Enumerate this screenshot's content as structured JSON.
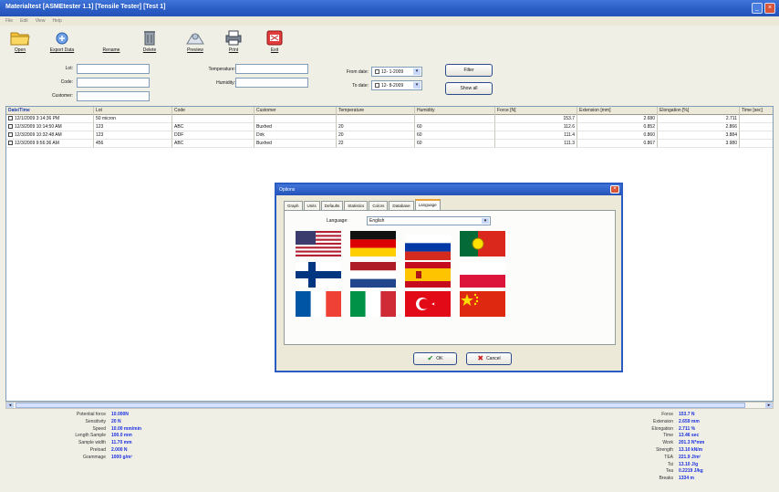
{
  "window": {
    "title": "Materialtest [ASMEtester 1.1] [Tensile Tester] [Test 1]"
  },
  "menu": [
    "File",
    "Edit",
    "View",
    "Help"
  ],
  "toolbar": [
    {
      "label": "Open",
      "icon": "folder-icon"
    },
    {
      "label": "Export Data",
      "icon": "export-icon"
    },
    {
      "label": "Rename",
      "icon": "rename-icon"
    },
    {
      "label": "Delete",
      "icon": "trash-icon"
    },
    {
      "label": "Preview",
      "icon": "preview-icon"
    },
    {
      "label": "Print",
      "icon": "printer-icon"
    },
    {
      "label": "Exit",
      "icon": "exit-icon"
    }
  ],
  "filters": {
    "lot_label": "Lot:",
    "lot_value": "",
    "code_label": "Code:",
    "code_value": "",
    "customer_label": "Customer:",
    "customer_value": "",
    "temperature_label": "Temperature:",
    "temperature_value": "",
    "humidity_label": "Humidity:",
    "humidity_value": "",
    "from_date_label": "From date:",
    "from_date_value": "12- 1-2009",
    "to_date_label": "To date:",
    "to_date_value": "12- 8-2009",
    "filter_button": "Filter",
    "show_all_button": "Show all"
  },
  "table": {
    "columns": [
      "Date/Time",
      "Lot",
      "Code",
      "Customer",
      "Temperature",
      "Humidity",
      "Force [N]",
      "Extension [mm]",
      "Elongation [%]",
      "Time [sec]"
    ],
    "rows": [
      [
        "12/1/2009 3:14:36 PM",
        "50 micron",
        "",
        "",
        "",
        "",
        "153.7",
        "2.680",
        "2.711",
        ""
      ],
      [
        "12/3/2009 10:14:50 AM",
        "123",
        "ABC",
        "Buxhed",
        "20",
        "60",
        "112.6",
        "0.852",
        "2.866",
        ""
      ],
      [
        "12/3/2009 10:32:48 AM",
        "123",
        "DDF",
        "Dirk",
        "20",
        "60",
        "111.4",
        "0.860",
        "3.884",
        ""
      ],
      [
        "12/3/2009 9:56:36 AM",
        "456",
        "ABC",
        "Buxhed",
        "22",
        "60",
        "111.3",
        "0.867",
        "3.980",
        ""
      ]
    ]
  },
  "settings_left": [
    {
      "label": "Potential force",
      "value": "10.000N"
    },
    {
      "label": "Sensitivity",
      "value": "20 N"
    },
    {
      "label": "Speed",
      "value": "10.00 mm/min"
    },
    {
      "label": "Length Sample",
      "value": "100.0 mm"
    },
    {
      "label": "Sample width",
      "value": "11.70 mm"
    },
    {
      "label": "Preload",
      "value": "2.000 N"
    },
    {
      "label": "Grammage",
      "value": "1000 g/m²"
    }
  ],
  "results_right": [
    {
      "label": "Force",
      "value": "153.7 N"
    },
    {
      "label": "Extension",
      "value": "2.659 mm"
    },
    {
      "label": "Elongation",
      "value": "2.711 %"
    },
    {
      "label": "Time",
      "value": "13.46 sec"
    },
    {
      "label": "Work",
      "value": "201.3 N*mm"
    },
    {
      "label": "Strength",
      "value": "13.10 kN/m"
    },
    {
      "label": "TEA",
      "value": "221.9 J/m²"
    },
    {
      "label": "Tsi",
      "value": "13.10 J/g"
    },
    {
      "label": "Tea",
      "value": "0.2219 J/kg"
    },
    {
      "label": "Breaks",
      "value": "1334 m"
    }
  ],
  "dialog": {
    "title": "Options",
    "tabs": [
      "Graph",
      "Units",
      "Defaults",
      "Statistics",
      "Colors",
      "Database",
      "Language"
    ],
    "active_tab": "Language",
    "language_label": "Language:",
    "language_value": "English",
    "flags": [
      "usa-flag",
      "germany-flag",
      "russia-flag",
      "portugal-flag",
      "finland-flag",
      "netherlands-flag",
      "spain-flag",
      "poland-flag",
      "france-flag",
      "italy-flag",
      "turkey-flag",
      "china-flag"
    ],
    "ok_button": "OK",
    "cancel_button": "Cancel",
    "colors": {
      "accent": "#2a5cc4",
      "tab_highlight": "#e8a23a"
    }
  }
}
